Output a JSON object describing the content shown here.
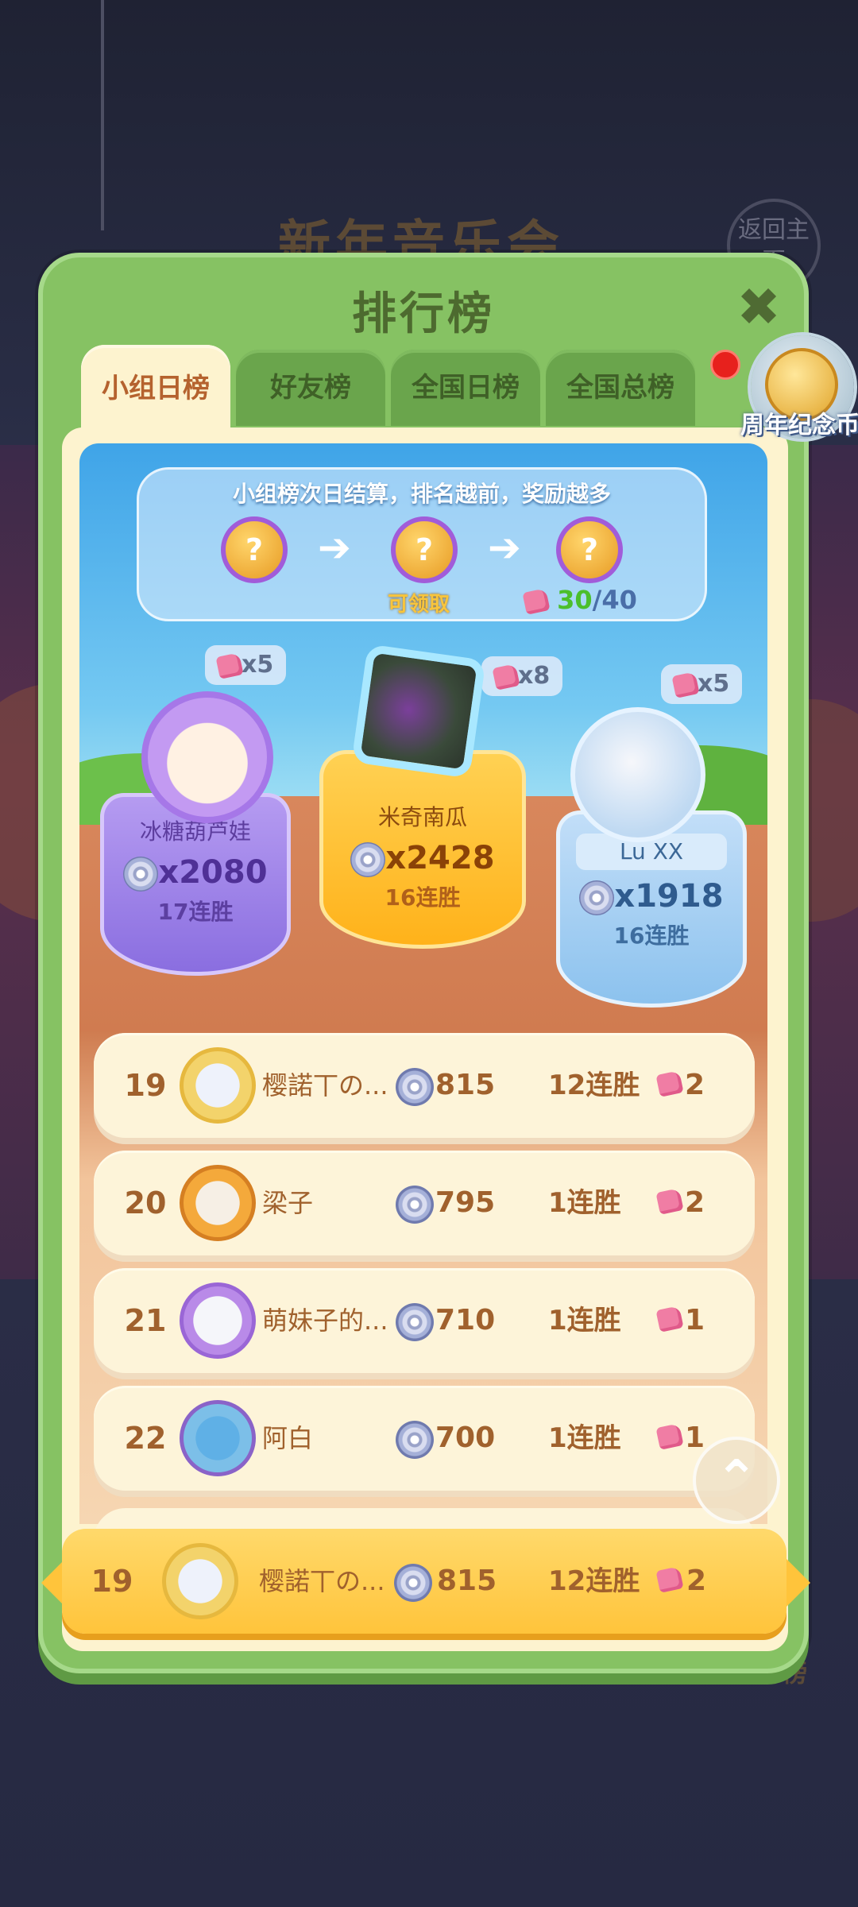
{
  "background": {
    "event_title": "新年音乐会",
    "return_button": "返回主页",
    "ranking_label": "排行榜"
  },
  "panel": {
    "title": "排行榜",
    "close_icon": "close-icon"
  },
  "tabs": [
    {
      "label": "小组日榜",
      "active": true
    },
    {
      "label": "好友榜",
      "active": false
    },
    {
      "label": "全国日榜",
      "active": false
    },
    {
      "label": "全国总榜",
      "active": false
    }
  ],
  "anniversary_coin": {
    "label": "周年纪念币"
  },
  "rewards": {
    "rule_text": "小组榜次日结算，排名越前，奖励越多",
    "orb_glyph": "?",
    "claim_label": "可领取",
    "progress_current": "30",
    "progress_total": "/40"
  },
  "podium": {
    "first": {
      "name": "米奇南瓜",
      "score": "x2428",
      "streak": "16连胜",
      "cards": "x8"
    },
    "second": {
      "name": "冰糖葫芦娃",
      "score": "x2080",
      "streak": "17连胜",
      "cards": "x5"
    },
    "third": {
      "name": "Lu XX",
      "score": "x1918",
      "streak": "16连胜",
      "cards": "x5"
    }
  },
  "rows": [
    {
      "rank": "19",
      "name": "樱諾丅の...",
      "score": "815",
      "streak": "12连胜",
      "cards": "2",
      "avatar_color": "#f3d36b"
    },
    {
      "rank": "20",
      "name": "梁子",
      "score": "795",
      "streak": "1连胜",
      "cards": "2",
      "avatar_color": "#f4a93b"
    },
    {
      "rank": "21",
      "name": "萌妹子的...",
      "score": "710",
      "streak": "1连胜",
      "cards": "1",
      "avatar_color": "#b98ae8"
    },
    {
      "rank": "22",
      "name": "阿白",
      "score": "700",
      "streak": "1连胜",
      "cards": "1",
      "avatar_color": "#7cbfe8"
    }
  ],
  "my_row": {
    "rank": "19",
    "name": "樱諾丅の...",
    "score": "815",
    "streak": "12连胜",
    "cards": "2"
  },
  "colors": {
    "panel_green": "#86c263",
    "tab_active": "#fdf3cf",
    "gold": "#ffc43b",
    "brown_text": "#a0612d"
  }
}
